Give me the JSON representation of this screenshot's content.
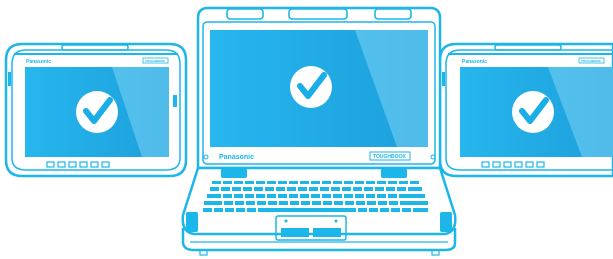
{
  "colors": {
    "outline": "#1cb6e8",
    "screen": "#23b3ec",
    "screen_dark": "#1398d6",
    "screen_light": "#7cd3f5",
    "check_circle": "#ffffff",
    "check_mark": "#1aaee8",
    "background": "#ffffff"
  },
  "devices": {
    "left_tablet": {
      "brand": "Panasonic",
      "model_badge": "TOUGHBOOK",
      "status": "check-mark-icon"
    },
    "laptop": {
      "brand": "Panasonic",
      "model_badge": "TOUGHBOOK",
      "status": "check-mark-icon"
    },
    "right_tablet": {
      "brand": "Panasonic",
      "model_badge": "TOUGHBOOK",
      "status": "check-mark-icon"
    }
  }
}
